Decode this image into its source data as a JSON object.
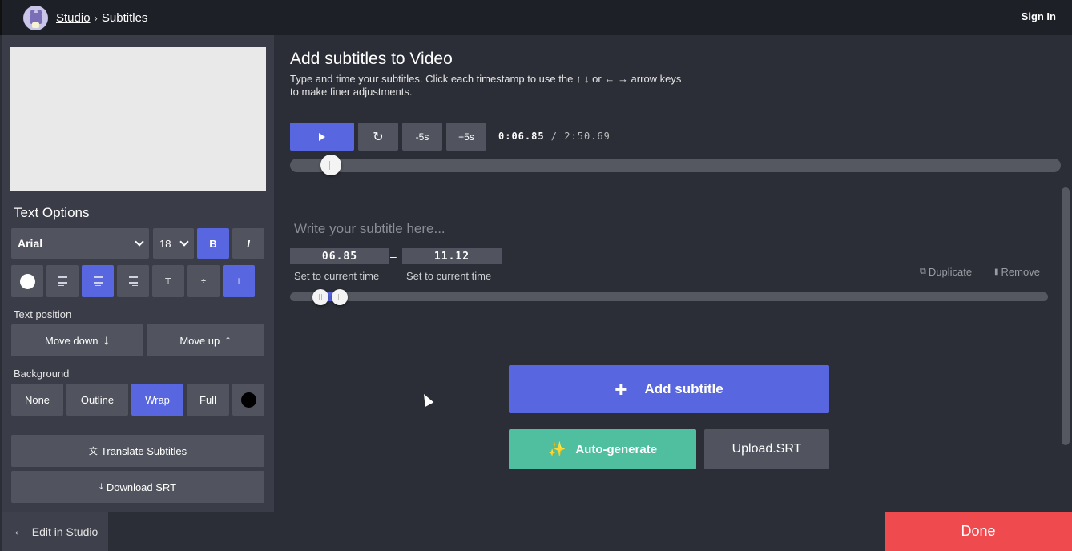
{
  "topbar": {
    "breadcrumb_studio": "Studio",
    "breadcrumb_sep": "›",
    "breadcrumb_current": "Subtitles",
    "sign_in": "Sign In"
  },
  "text_options": {
    "heading": "Text Options",
    "font": "Arial",
    "font_size": "18",
    "bold_label": "B",
    "italic_label": "I",
    "text_position_label": "Text position",
    "move_down": "Move down",
    "move_up": "Move up",
    "background_label": "Background",
    "bg_options": [
      "None",
      "Outline",
      "Wrap",
      "Full"
    ],
    "translate": "Translate Subtitles",
    "download": "Download SRT"
  },
  "editor": {
    "title": "Add subtitles to Video",
    "subtitle": "Type and time your subtitles. Click each timestamp to use the ↑ ↓ or ← → arrow keys to make finer adjustments.",
    "minus5": "-5s",
    "plus5": "+5s",
    "current_time": "0:06.85",
    "time_sep": " / ",
    "total_time": "2:50.69",
    "playback_progress": 0.04
  },
  "subtitle_item": {
    "placeholder": "Write your subtitle here...",
    "start": "06.85",
    "dash": "–",
    "end": "11.12",
    "set_current": "Set to current time",
    "duplicate": "Duplicate",
    "remove": "Remove"
  },
  "actions": {
    "add_subtitle": "Add subtitle",
    "auto_generate": "Auto-generate",
    "upload_srt": "Upload.SRT"
  },
  "bottom": {
    "edit_in_studio": "Edit in Studio",
    "done": "Done"
  },
  "colors": {
    "accent": "#5866e0",
    "teal": "#4fbfa0",
    "done_red": "#ef4a4e"
  }
}
